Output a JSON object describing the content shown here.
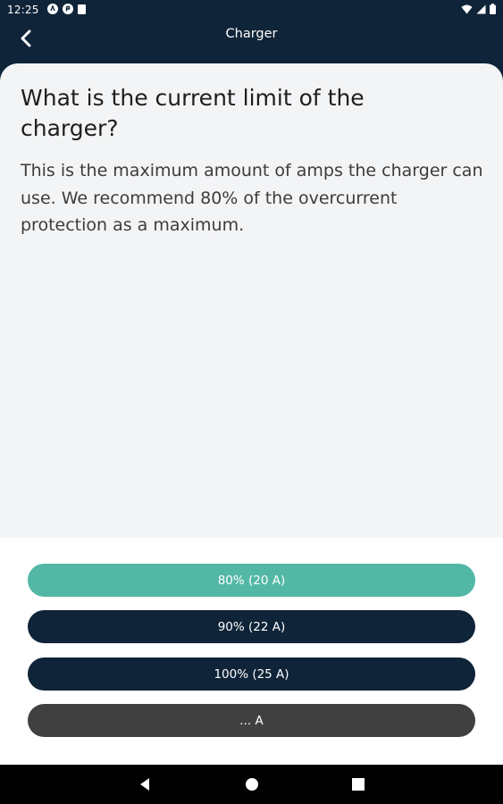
{
  "status_bar": {
    "time": "12:25",
    "icons": [
      "notification-circle-icon",
      "app-circle-icon",
      "sd-card-icon"
    ],
    "right_icons": [
      "wifi-icon",
      "signal-icon",
      "battery-icon"
    ]
  },
  "header": {
    "title": "Charger",
    "back_icon": "chevron-left-icon"
  },
  "question": {
    "title": "What is the current limit of the charger?",
    "description": "This is the maximum amount of amps the charger can use. We recommend 80% of the overcurrent protection as a maximum."
  },
  "answers": [
    {
      "label": "80% (20 A)",
      "color": "#52b8a5",
      "selected": true
    },
    {
      "label": "90% (22 A)",
      "color": "#0f2438",
      "selected": false
    },
    {
      "label": "100% (25 A)",
      "color": "#0f2438",
      "selected": false
    },
    {
      "label": "... A",
      "color": "#404040",
      "selected": false
    }
  ],
  "nav": {
    "icons": [
      "back-triangle-icon",
      "home-circle-icon",
      "recents-square-icon"
    ]
  },
  "colors": {
    "primary_dark": "#0f2438",
    "accent": "#52b8a5",
    "custom_button": "#404040",
    "card_background": "#f3f4f6"
  }
}
